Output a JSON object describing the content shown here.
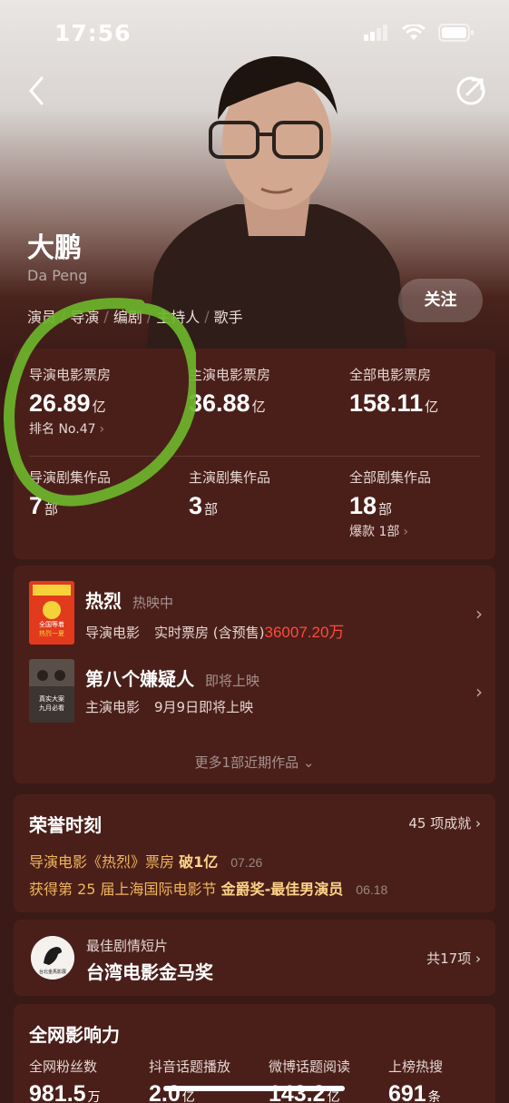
{
  "status_bar": {
    "time": "17:56"
  },
  "profile": {
    "name": "大鹏",
    "name_en": "Da Peng",
    "roles": [
      "演员",
      "导演",
      "编剧",
      "主持人",
      "歌手"
    ],
    "role_separator": "/",
    "follow_label": "关注"
  },
  "stats": {
    "box_director": {
      "label": "导演电影票房",
      "value": "26.89",
      "unit": "亿",
      "rank": "排名 No.47"
    },
    "box_lead": {
      "label": "主演电影票房",
      "value": "36.88",
      "unit": "亿"
    },
    "box_all": {
      "label": "全部电影票房",
      "value": "158.11",
      "unit": "亿"
    },
    "series_director": {
      "label": "导演剧集作品",
      "value": "7",
      "unit": "部"
    },
    "series_lead": {
      "label": "主演剧集作品",
      "value": "3",
      "unit": "部"
    },
    "series_all": {
      "label": "全部剧集作品",
      "value": "18",
      "unit": "部",
      "hit": "爆款 1部"
    }
  },
  "works": [
    {
      "title": "热烈",
      "status": "热映中",
      "role": "导演电影",
      "meta": "实时票房 (含预售)",
      "box": "36007.20万",
      "poster_text": [
        "全国等着",
        "热烈一夏"
      ]
    },
    {
      "title": "第八个嫌疑人",
      "status": "即将上映",
      "role": "主演电影",
      "meta": "9月9日即将上映",
      "poster_text": [
        "真实大案",
        "九月必看"
      ]
    }
  ],
  "more_works": "更多1部近期作品",
  "honors": {
    "title": "荣誉时刻",
    "count": "45 项成就",
    "items": [
      {
        "prefix": "导演电影《热烈》票房",
        "highlight": "破1亿",
        "date": "07.26"
      },
      {
        "prefix": "获得第 25 届上海国际电影节",
        "highlight": "金爵奖-最佳男演员",
        "date": "06.18"
      }
    ]
  },
  "award": {
    "category": "最佳剧情短片",
    "name": "台湾电影金马奖",
    "count": "共17项",
    "logo_text": "台北金馬影展"
  },
  "influence": {
    "title": "全网影响力",
    "items": [
      {
        "label": "全网粉丝数",
        "value": "981.5",
        "unit": "万"
      },
      {
        "label": "抖音话题播放",
        "value": "2.0",
        "unit": "亿"
      },
      {
        "label": "微博话题阅读",
        "value": "143.2",
        "unit": "亿"
      },
      {
        "label": "上榜热搜",
        "value": "691",
        "unit": "条"
      }
    ]
  },
  "colors": {
    "background": "#3a1a16",
    "card": "#4a1f1a",
    "highlight_red": "#ff4b3a",
    "honor_gold": "#f0b65a",
    "annotation_green": "#6cb52a"
  }
}
